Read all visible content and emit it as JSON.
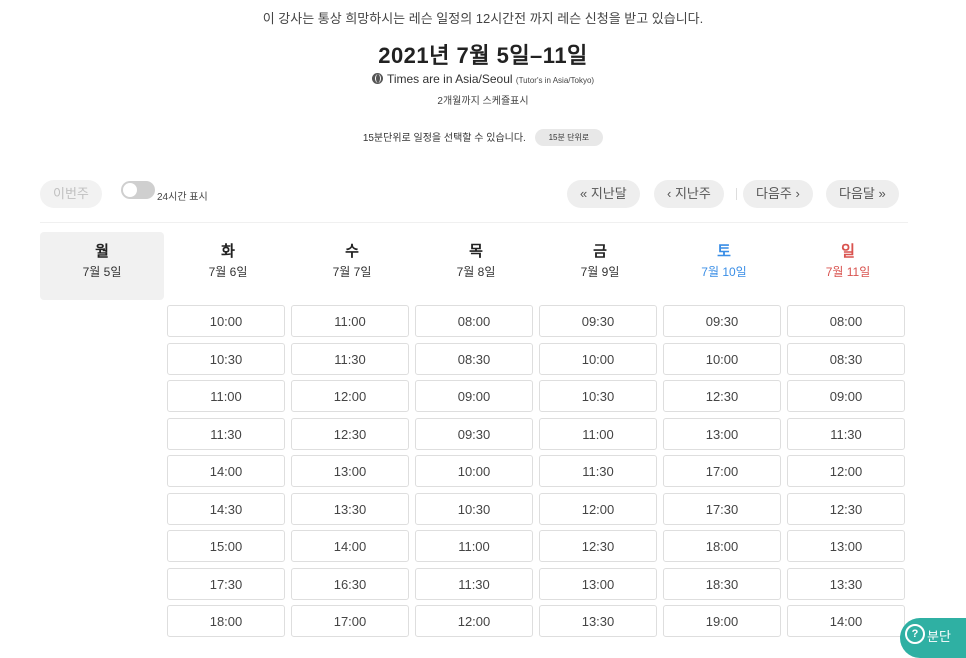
{
  "notice": "이 강사는 통상 희망하시는 레슨 일정의 12시간전 까지 레슨 신청을 받고 있습니다.",
  "title": "2021년 7월 5일–11일",
  "timezone": {
    "main": "Times are in Asia/Seoul",
    "tutor": "(Tutor's in Asia/Tokyo)"
  },
  "months_note": "2개월까지 스케쥴표시",
  "unit": {
    "text": "15분단위로 일정을 선택할 수 있습니다.",
    "button": "15분 단위로"
  },
  "nav": {
    "this_week": "이번주",
    "toggle_label": "24시간 표시",
    "prev_month": "« 지난달",
    "prev_week": "‹ 지난주",
    "next_week": "다음주 ›",
    "next_month": "다음달 »"
  },
  "days": [
    {
      "name": "월",
      "date": "7월 5일",
      "slots": []
    },
    {
      "name": "화",
      "date": "7월 6일",
      "slots": [
        "10:00",
        "10:30",
        "11:00",
        "11:30",
        "14:00",
        "14:30",
        "15:00",
        "17:30",
        "18:00"
      ]
    },
    {
      "name": "수",
      "date": "7월 7일",
      "slots": [
        "11:00",
        "11:30",
        "12:00",
        "12:30",
        "13:00",
        "13:30",
        "14:00",
        "16:30",
        "17:00"
      ]
    },
    {
      "name": "목",
      "date": "7월 8일",
      "slots": [
        "08:00",
        "08:30",
        "09:00",
        "09:30",
        "10:00",
        "10:30",
        "11:00",
        "11:30",
        "12:00"
      ]
    },
    {
      "name": "금",
      "date": "7월 9일",
      "slots": [
        "09:30",
        "10:00",
        "10:30",
        "11:00",
        "11:30",
        "12:00",
        "12:30",
        "13:00",
        "13:30"
      ]
    },
    {
      "name": "토",
      "date": "7월 10일",
      "slots": [
        "09:30",
        "10:00",
        "12:30",
        "13:00",
        "17:00",
        "17:30",
        "18:00",
        "18:30",
        "19:00"
      ]
    },
    {
      "name": "일",
      "date": "7월 11일",
      "slots": [
        "08:00",
        "08:30",
        "09:00",
        "11:30",
        "12:00",
        "12:30",
        "13:00",
        "13:30",
        "14:00"
      ]
    }
  ],
  "help": {
    "label": "분단"
  },
  "colors": {
    "saturday": "#3a8ee6",
    "sunday": "#d9534f",
    "help_bg": "#2fb0a3"
  }
}
